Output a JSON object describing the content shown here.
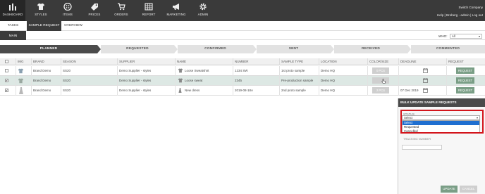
{
  "nav": {
    "items": [
      {
        "label": "DASHBOARD",
        "icon": "bar-chart-icon"
      },
      {
        "label": "STYLES",
        "icon": "shirt-icon"
      },
      {
        "label": "ITEMS",
        "icon": "button-icon"
      },
      {
        "label": "PRICES",
        "icon": "price-tag-icon"
      },
      {
        "label": "ORDERS",
        "icon": "cart-icon"
      },
      {
        "label": "REPORT",
        "icon": "table-icon"
      },
      {
        "label": "MARKETING",
        "icon": "megaphone-icon"
      },
      {
        "label": "ADMIN",
        "icon": "gear-icon"
      }
    ],
    "company": "Switch Company",
    "user_links": "Help | Broberg - admin | Log out"
  },
  "tabs": [
    "TASKS",
    "SAMPLE REQUEST",
    "OVERVIEW"
  ],
  "subtabs": [
    "MAIN"
  ],
  "who": {
    "label": "WHO:",
    "value": "All"
  },
  "stages": [
    "PLANNED",
    "REQUESTED",
    "CONFIRMED",
    "SENT",
    "RECEIVED",
    "COMMENTED"
  ],
  "columns": [
    "IMG",
    "BRAND",
    "SEASON",
    "SUPPLIER",
    "NAME",
    "NUMBER",
    "SAMPLE TYPE",
    "LOCATION",
    "COLOR/SIZE",
    "DEADLINE",
    "REQUEST"
  ],
  "rows": [
    {
      "checked": "",
      "brand": "Brand Demo",
      "season": "SS20",
      "supplier": "Demo Supplier - styles",
      "name": "Loose Sweatshirt",
      "number": "1234 SW",
      "sample_type": "1st proto sample",
      "location": "Demo HQ",
      "color_size": "0 PCS",
      "deadline": "",
      "request": "REQUEST"
    },
    {
      "checked": "✔",
      "brand": "Brand Demo",
      "season": "SS20",
      "supplier": "Demo Supplier - styles",
      "name": "Loose sweat",
      "number": "2345",
      "sample_type": "Pre-production sample",
      "location": "Demo HQ",
      "color_size": "",
      "deadline": "",
      "request": "REQUEST"
    },
    {
      "checked": "✔",
      "brand": "Brand Demo",
      "season": "SS20",
      "supplier": "Demo Supplier - styles",
      "name": "New dress",
      "number": "2019-08-18A",
      "sample_type": "2nd proto sample",
      "location": "Demo HQ",
      "color_size": "2 PCS",
      "deadline": "07 Dec 2019",
      "request": "REQUEST"
    }
  ],
  "bulk_panel": {
    "title": "BULK UPDATE SAMPLE REQUESTS",
    "status_label": "STATUS",
    "select_value": "Select",
    "options": [
      "Select",
      "Requested",
      "Cancelled"
    ],
    "delivery_label": "TRACKING NUMBER",
    "update_label": "UPDATE",
    "cancel_label": "CANCEL"
  },
  "colors": {
    "nav_bg": "#3a3a3a",
    "accent_green": "#7a9e86",
    "highlight_red": "#d3141b",
    "option_blue": "#1f6fd0"
  }
}
